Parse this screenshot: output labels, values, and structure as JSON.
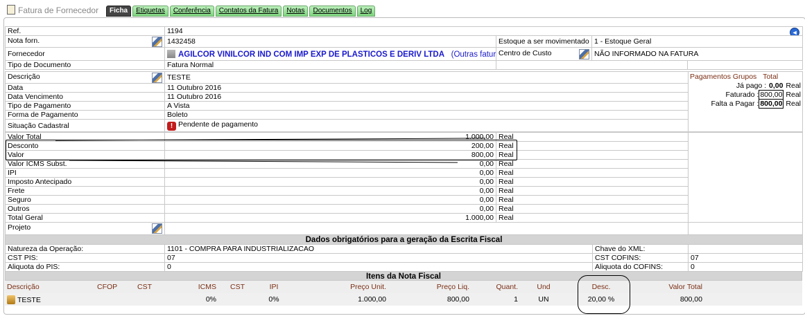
{
  "app_title": "Fatura de Fornecedor",
  "tabs": [
    {
      "label": "Ficha"
    },
    {
      "label": "Etiquetas"
    },
    {
      "label": "Conferência"
    },
    {
      "label": "Contatos da Fatura"
    },
    {
      "label": "Notas"
    },
    {
      "label": "Documentos"
    },
    {
      "label": "Log"
    }
  ],
  "fields": {
    "ref_label": "Ref.",
    "ref_value": "1194",
    "nota_label": "Nota forn.",
    "nota_value": "1432458",
    "estoque_label": "Estoque a ser movimentado",
    "estoque_value": "1 - Estoque Geral",
    "fornecedor_label": "Fornecedor",
    "fornecedor_value": "AGILCOR VINILCOR IND COM IMP EXP DE PLASTICOS E DERIV LTDA",
    "outras_faturas": "(Outras faturas)",
    "paren_close": ")",
    "centro_label": "Centro de Custo",
    "centro_value": "NÃO INFORMADO NA FATURA",
    "tipo_doc_label": "Tipo de Documento",
    "tipo_doc_value": "Fatura Normal",
    "descricao_label": "Descrição",
    "descricao_value": "TESTE",
    "data_label": "Data",
    "data_value": "11 Outubro 2016",
    "venc_label": "Data Vencimento",
    "venc_value": "11 Outubro 2016",
    "tipo_pag_label": "Tipo de Pagamento",
    "tipo_pag_value": "A Vista",
    "forma_pag_label": "Forma de Pagamento",
    "forma_pag_value": "Boleto",
    "situacao_label": "Situação Cadastral",
    "situacao_value": "Pendente de pagamento",
    "projeto_label": "Projeto"
  },
  "payments": {
    "title": "Pagamentos Grupos",
    "total_label": "Total",
    "ja_pago_label": "Já pago :",
    "ja_pago_value": "0,00",
    "faturado_label": "Faturado :",
    "faturado_value": "800,00",
    "falta_label": "Falta a Pagar :",
    "falta_value": "800,00",
    "currency": "Real"
  },
  "values": [
    {
      "label": "Valor Total",
      "value": "1.000,00",
      "unit": "Real"
    },
    {
      "label": "Desconto",
      "value": "200,00",
      "unit": "Real"
    },
    {
      "label": "Valor",
      "value": "800,00",
      "unit": "Real"
    },
    {
      "label": "Valor ICMS Subst.",
      "value": "0,00",
      "unit": "Real"
    },
    {
      "label": "IPI",
      "value": "0,00",
      "unit": "Real"
    },
    {
      "label": "Imposto Antecipado",
      "value": "0,00",
      "unit": "Real"
    },
    {
      "label": "Frete",
      "value": "0,00",
      "unit": "Real"
    },
    {
      "label": "Seguro",
      "value": "0,00",
      "unit": "Real"
    },
    {
      "label": "Outros",
      "value": "0,00",
      "unit": "Real"
    },
    {
      "label": "Total Geral",
      "value": "1.000,00",
      "unit": "Real"
    }
  ],
  "fiscal": {
    "title": "Dados obrigatórios para a geração da Escrita Fiscal",
    "natureza_label": "Natureza da Operação:",
    "natureza_value": "1101 - COMPRA PARA INDUSTRIALIZACAO",
    "chave_label": "Chave do XML:",
    "chave_value": "",
    "cst_pis_label": "CST PIS:",
    "cst_pis_value": "07",
    "cst_cofins_label": "CST COFINS:",
    "cst_cofins_value": "07",
    "aliq_pis_label": "Aliquota do PIS:",
    "aliq_pis_value": "0",
    "aliq_cofins_label": "Aliquota do COFINS:",
    "aliq_cofins_value": "0"
  },
  "items": {
    "title": "Itens da Nota Fiscal",
    "headers": [
      "Descrição",
      "CFOP",
      "CST",
      "ICMS",
      "CST",
      "IPI",
      "Preço Unit.",
      "Preço Liq.",
      "Quant.",
      "Und",
      "Desc.",
      "Valor Total"
    ],
    "rows": [
      [
        "TESTE",
        "",
        "",
        "0%",
        "",
        "0%",
        "1.000,00",
        "800,00",
        "1",
        "UN",
        "20,00 %",
        "800,00"
      ]
    ]
  }
}
